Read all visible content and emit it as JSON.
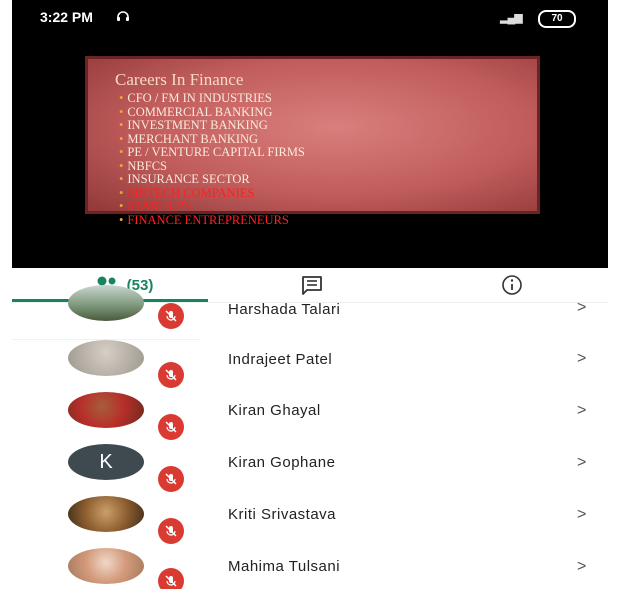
{
  "status": {
    "time": "3:22 PM",
    "battery": "70"
  },
  "slide": {
    "title": "Careers In Finance",
    "items": [
      {
        "text": "CFO / FM IN INDUSTRIES",
        "color": "white"
      },
      {
        "text": "COMMERCIAL BANKING",
        "color": "white"
      },
      {
        "text": "INVESTMENT BANKING",
        "color": "white"
      },
      {
        "text": "MERCHANT BANKING",
        "color": "white"
      },
      {
        "text": "PE / VENTURE CAPITAL FIRMS",
        "color": "white"
      },
      {
        "text": "NBFCS",
        "color": "white"
      },
      {
        "text": "INSURANCE SECTOR",
        "color": "white"
      },
      {
        "text": "FINTECH COMPANIES",
        "color": "red"
      },
      {
        "text": "START-UPS",
        "color": "red"
      },
      {
        "text": "FINANCE ENTREPRENEURS",
        "color": "red"
      }
    ]
  },
  "tabs": {
    "participants_count": "(53)",
    "accent": "#18835f",
    "icons": [
      "people-icon",
      "chat-icon",
      "info-icon"
    ]
  },
  "participants": [
    {
      "name": "Harshada Talari",
      "avatar": "photo"
    },
    {
      "name": "Indrajeet Patel",
      "avatar": "photo"
    },
    {
      "name": "Kiran Ghayal",
      "avatar": "photo"
    },
    {
      "name": "Kiran Gophane",
      "avatar": "initial",
      "initial": "K"
    },
    {
      "name": "Kriti Srivastava",
      "avatar": "photo"
    },
    {
      "name": "Mahima Tulsani",
      "avatar": "photo"
    }
  ],
  "chevron": ">",
  "colors": {
    "muted_mic": "#d93b32"
  }
}
